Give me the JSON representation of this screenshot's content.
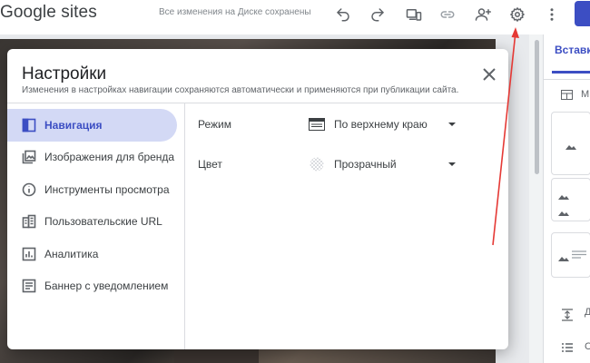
{
  "app": {
    "name": "Google sites",
    "save_status": "Все изменения на Диске сохранены"
  },
  "toolbar": {
    "icons": [
      "undo-icon",
      "redo-icon",
      "preview-device-icon",
      "link-icon",
      "add-person-icon",
      "settings-icon",
      "more-vert-icon"
    ]
  },
  "right_panel": {
    "tab_label": "Вставка",
    "row_label": "М",
    "bottom_label_1": "Д",
    "bottom_label_2": "С"
  },
  "dialog": {
    "title": "Настройки",
    "subtitle": "Изменения в настройках навигации сохраняются автоматически и применяются при публикации сайта.",
    "nav": [
      {
        "label": "Навигация",
        "icon": "navigation-icon",
        "active": true
      },
      {
        "label": "Изображения для бренда",
        "icon": "brand-images-icon",
        "active": false
      },
      {
        "label": "Инструменты просмотра",
        "icon": "info-icon",
        "active": false
      },
      {
        "label": "Пользовательские URL",
        "icon": "custom-url-icon",
        "active": false
      },
      {
        "label": "Аналитика",
        "icon": "analytics-icon",
        "active": false
      },
      {
        "label": "Баннер с уведомлением",
        "icon": "banner-icon",
        "active": false
      }
    ],
    "settings": {
      "mode_label": "Режим",
      "mode_value": "По верхнему краю",
      "color_label": "Цвет",
      "color_value": "Прозрачный"
    }
  },
  "colors": {
    "accent": "#3c4ec3",
    "active_nav_bg": "#d3d9f5",
    "annotation_arrow": "#e53935"
  }
}
